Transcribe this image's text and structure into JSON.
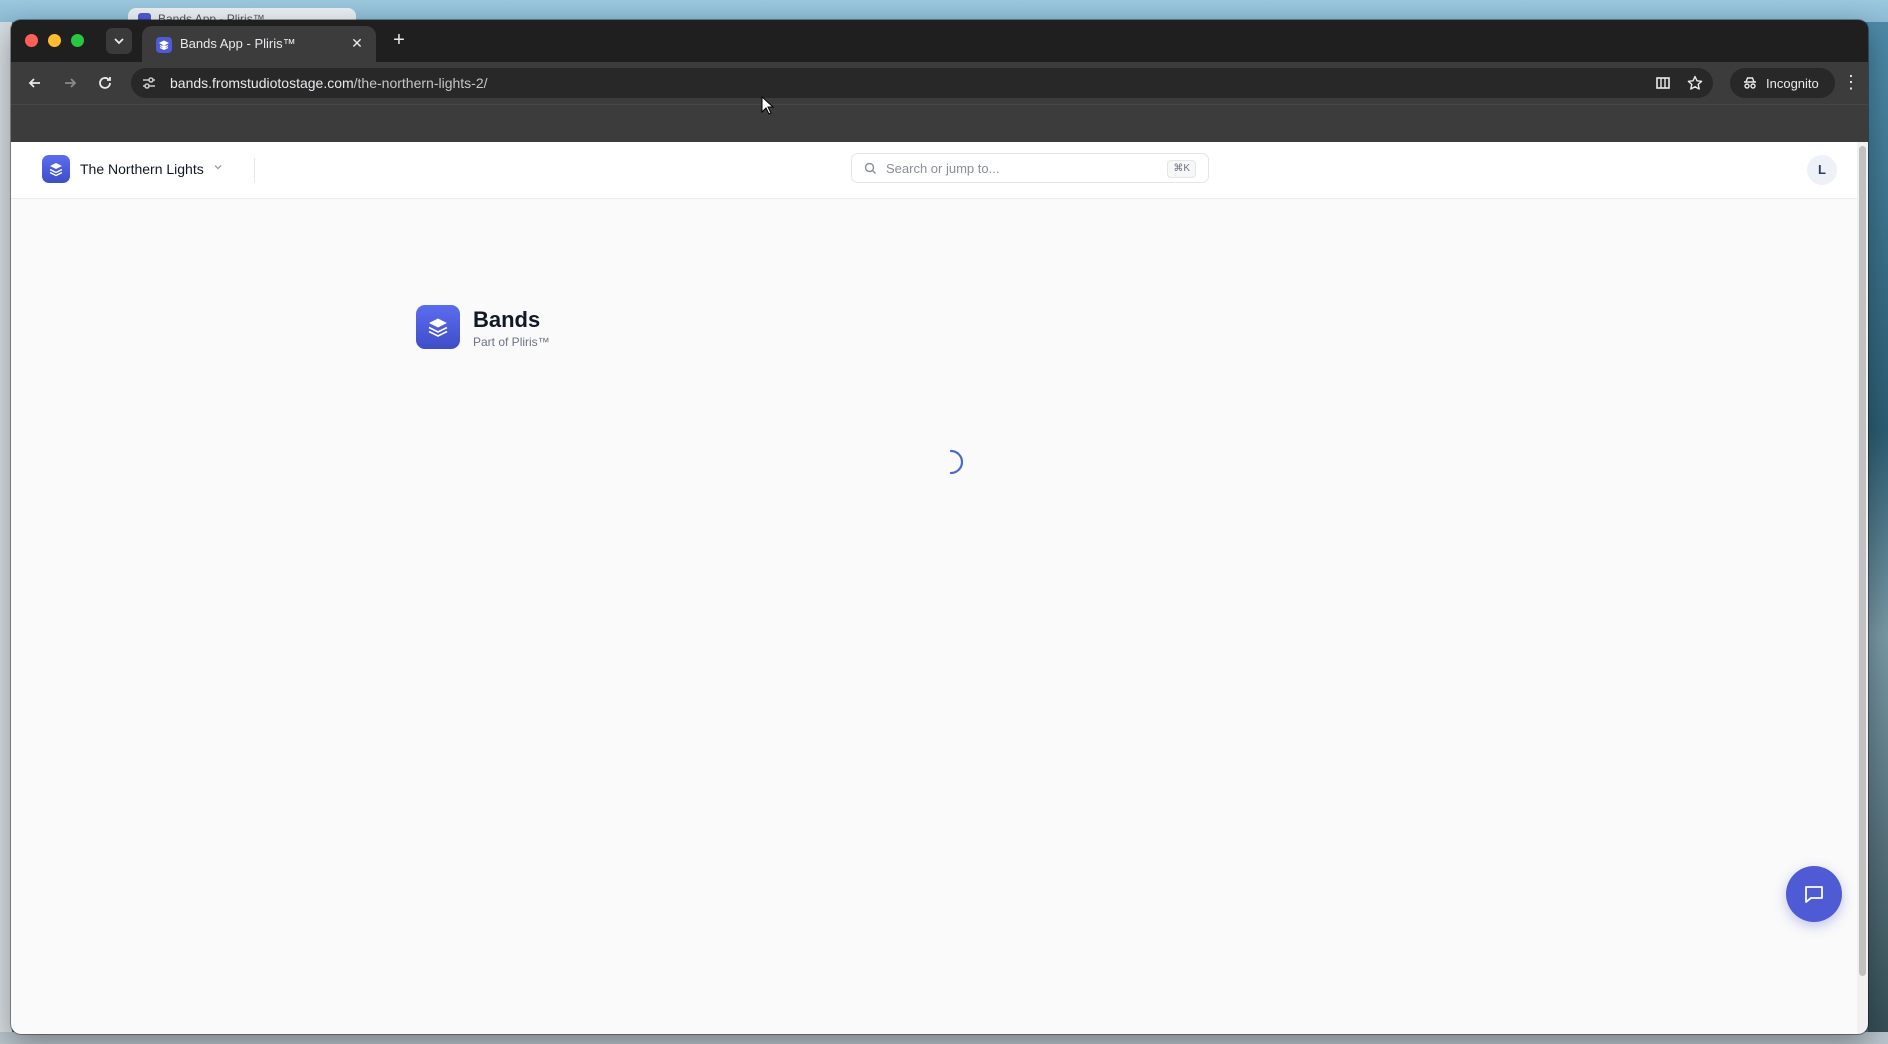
{
  "desktop": {
    "background_tab_title": "Bands App - Pliris™"
  },
  "browser": {
    "tab": {
      "title": "Bands App - Pliris™"
    },
    "url": {
      "host": "bands.fromstudiotostage.com",
      "path": "/the-northern-lights-2/"
    },
    "incognito_label": "Incognito"
  },
  "app": {
    "band_name": "The Northern Lights",
    "search_placeholder": "Search or jump to...",
    "search_shortcut": "⌘K",
    "avatar_initial": "L",
    "brand": {
      "title": "Bands",
      "subtitle": "Part of Pliris™"
    }
  },
  "colors": {
    "accent": "#4f5bd5",
    "tab_bg": "#3c3c3c",
    "page_bg": "#fafafa"
  }
}
